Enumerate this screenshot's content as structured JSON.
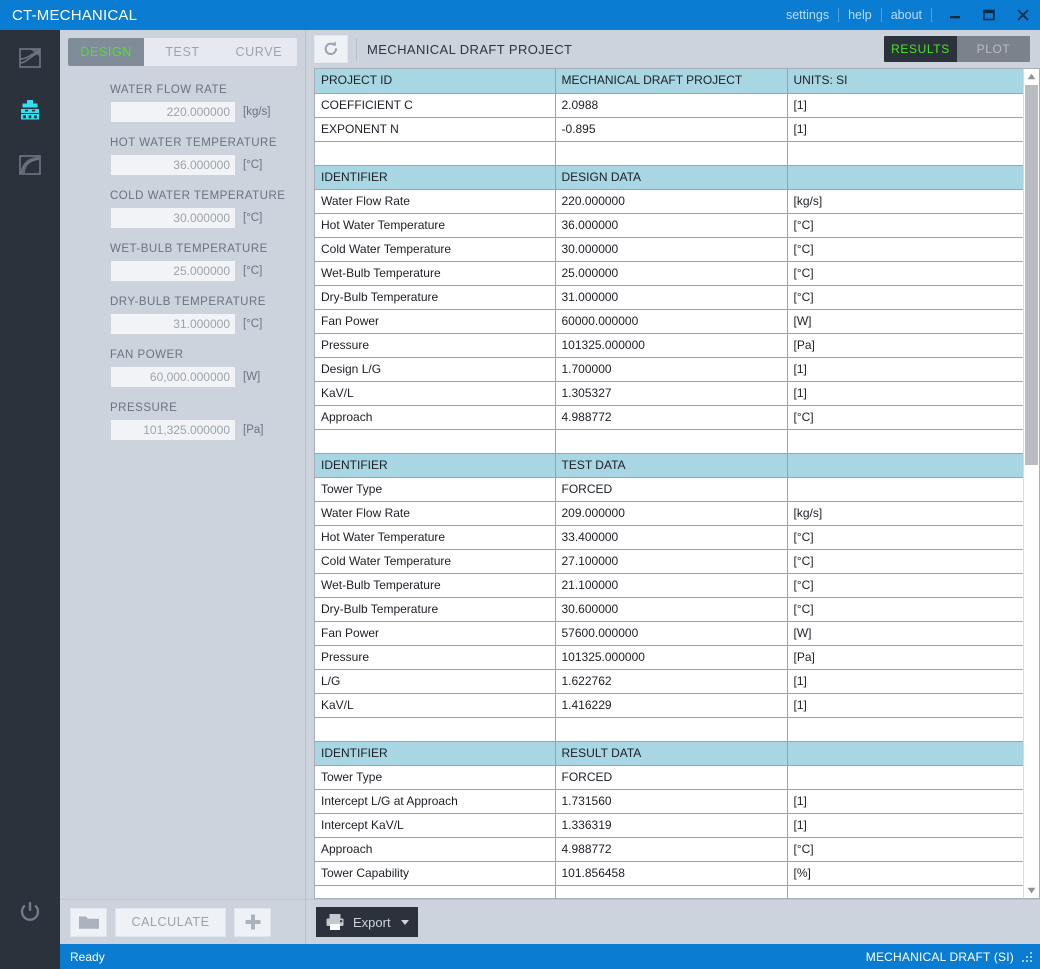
{
  "window": {
    "title": "CT-MECHANICAL",
    "menu": [
      "settings",
      "help",
      "about"
    ],
    "minimize_icon": "minimize-icon",
    "maximize_icon": "maximize-icon",
    "close_icon": "close-icon"
  },
  "rail": {
    "items": [
      {
        "name": "chart-icon",
        "label": "Chart View",
        "active": false
      },
      {
        "name": "cooling-tower-icon",
        "label": "Mechanical Draft",
        "active": true
      },
      {
        "name": "curve-icon",
        "label": "Curve View",
        "active": false
      }
    ],
    "power_icon": "power-icon",
    "accent": "#33e0f0"
  },
  "left_panel": {
    "tabs": [
      {
        "label": "DESIGN",
        "active": true
      },
      {
        "label": "TEST",
        "active": false
      },
      {
        "label": "CURVE",
        "active": false
      }
    ],
    "fields": [
      {
        "label": "WATER FLOW RATE",
        "value": "220.000000",
        "unit": "[kg/s]"
      },
      {
        "label": "HOT WATER TEMPERATURE",
        "value": "36.000000",
        "unit": "[°C]"
      },
      {
        "label": "COLD WATER TEMPERATURE",
        "value": "30.000000",
        "unit": "[°C]"
      },
      {
        "label": "WET-BULB TEMPERATURE",
        "value": "25.000000",
        "unit": "[°C]"
      },
      {
        "label": "DRY-BULB TEMPERATURE",
        "value": "31.000000",
        "unit": "[°C]"
      },
      {
        "label": "FAN POWER",
        "value": "60,000.000000",
        "unit": "[W]"
      },
      {
        "label": "PRESSURE",
        "value": "101,325.000000",
        "unit": "[Pa]"
      }
    ],
    "bottom_bar": {
      "folder_icon": "folder-icon",
      "calculate_label": "CALCULATE",
      "plus_icon": "plus-icon"
    }
  },
  "right_panel": {
    "refresh_icon": "refresh-icon",
    "title": "MECHANICAL DRAFT PROJECT",
    "view_toggle": [
      {
        "label": "RESULTS",
        "active": true
      },
      {
        "label": "PLOT",
        "active": false
      }
    ],
    "export": {
      "icon": "printer-icon",
      "label": "Export",
      "caret": "chevron-down-icon"
    },
    "scrollbar": {
      "up_arrow": "caret-up-icon",
      "down_arrow": "caret-down-icon"
    }
  },
  "table": {
    "rows": [
      {
        "type": "header",
        "cells": [
          "PROJECT ID",
          "MECHANICAL DRAFT PROJECT",
          "UNITS: SI"
        ]
      },
      {
        "type": "data",
        "cells": [
          "COEFFICIENT C",
          "2.0988",
          "[1]"
        ]
      },
      {
        "type": "data",
        "cells": [
          "EXPONENT N",
          "-0.895",
          "[1]"
        ]
      },
      {
        "type": "blank",
        "cells": [
          "",
          "",
          ""
        ]
      },
      {
        "type": "header",
        "cells": [
          "IDENTIFIER",
          "DESIGN DATA",
          ""
        ]
      },
      {
        "type": "data",
        "cells": [
          "Water Flow Rate",
          "220.000000",
          "[kg/s]"
        ]
      },
      {
        "type": "data",
        "cells": [
          "Hot Water Temperature",
          "36.000000",
          "[°C]"
        ]
      },
      {
        "type": "data",
        "cells": [
          "Cold Water Temperature",
          "30.000000",
          "[°C]"
        ]
      },
      {
        "type": "data",
        "cells": [
          "Wet-Bulb Temperature",
          "25.000000",
          "[°C]"
        ]
      },
      {
        "type": "data",
        "cells": [
          "Dry-Bulb Temperature",
          "31.000000",
          "[°C]"
        ]
      },
      {
        "type": "data",
        "cells": [
          "Fan Power",
          "60000.000000",
          "[W]"
        ]
      },
      {
        "type": "data",
        "cells": [
          "Pressure",
          "101325.000000",
          "[Pa]"
        ]
      },
      {
        "type": "data",
        "cells": [
          "Design L/G",
          "1.700000",
          "[1]"
        ]
      },
      {
        "type": "data",
        "cells": [
          "KaV/L",
          "1.305327",
          "[1]"
        ]
      },
      {
        "type": "data",
        "cells": [
          "Approach",
          "4.988772",
          "[°C]"
        ]
      },
      {
        "type": "blank",
        "cells": [
          "",
          "",
          ""
        ]
      },
      {
        "type": "header",
        "cells": [
          "IDENTIFIER",
          "TEST DATA",
          ""
        ]
      },
      {
        "type": "data",
        "cells": [
          "Tower Type",
          "FORCED",
          ""
        ]
      },
      {
        "type": "data",
        "cells": [
          "Water Flow Rate",
          "209.000000",
          "[kg/s]"
        ]
      },
      {
        "type": "data",
        "cells": [
          "Hot Water Temperature",
          "33.400000",
          "[°C]"
        ]
      },
      {
        "type": "data",
        "cells": [
          "Cold Water Temperature",
          "27.100000",
          "[°C]"
        ]
      },
      {
        "type": "data",
        "cells": [
          "Wet-Bulb Temperature",
          "21.100000",
          "[°C]"
        ]
      },
      {
        "type": "data",
        "cells": [
          "Dry-Bulb Temperature",
          "30.600000",
          "[°C]"
        ]
      },
      {
        "type": "data",
        "cells": [
          "Fan Power",
          "57600.000000",
          "[W]"
        ]
      },
      {
        "type": "data",
        "cells": [
          "Pressure",
          "101325.000000",
          "[Pa]"
        ]
      },
      {
        "type": "data",
        "cells": [
          "L/G",
          "1.622762",
          "[1]"
        ]
      },
      {
        "type": "data",
        "cells": [
          "KaV/L",
          "1.416229",
          "[1]"
        ]
      },
      {
        "type": "blank",
        "cells": [
          "",
          "",
          ""
        ]
      },
      {
        "type": "header",
        "cells": [
          "IDENTIFIER",
          "RESULT DATA",
          ""
        ]
      },
      {
        "type": "data",
        "cells": [
          "Tower Type",
          "FORCED",
          ""
        ]
      },
      {
        "type": "data",
        "cells": [
          "Intercept L/G at Approach",
          "1.731560",
          "[1]"
        ]
      },
      {
        "type": "data",
        "cells": [
          "Intercept KaV/L",
          "1.336319",
          "[1]"
        ]
      },
      {
        "type": "data",
        "cells": [
          "Approach",
          "4.988772",
          "[°C]"
        ]
      },
      {
        "type": "data",
        "cells": [
          "Tower Capability",
          "101.856458",
          "[%]"
        ]
      },
      {
        "type": "blank",
        "cells": [
          "",
          "",
          ""
        ]
      }
    ]
  },
  "status_bar": {
    "left": "Ready",
    "right": "MECHANICAL DRAFT (SI)",
    "grip_icon": "resize-grip-icon"
  },
  "colors": {
    "title_blue": "#0a7cd1",
    "rail_dark": "#2b323c",
    "panel_gray": "#ccd3dd",
    "header_blue": "#a9d6e3",
    "accent_green": "#4ee22a",
    "accent_cyan": "#33e0f0"
  }
}
